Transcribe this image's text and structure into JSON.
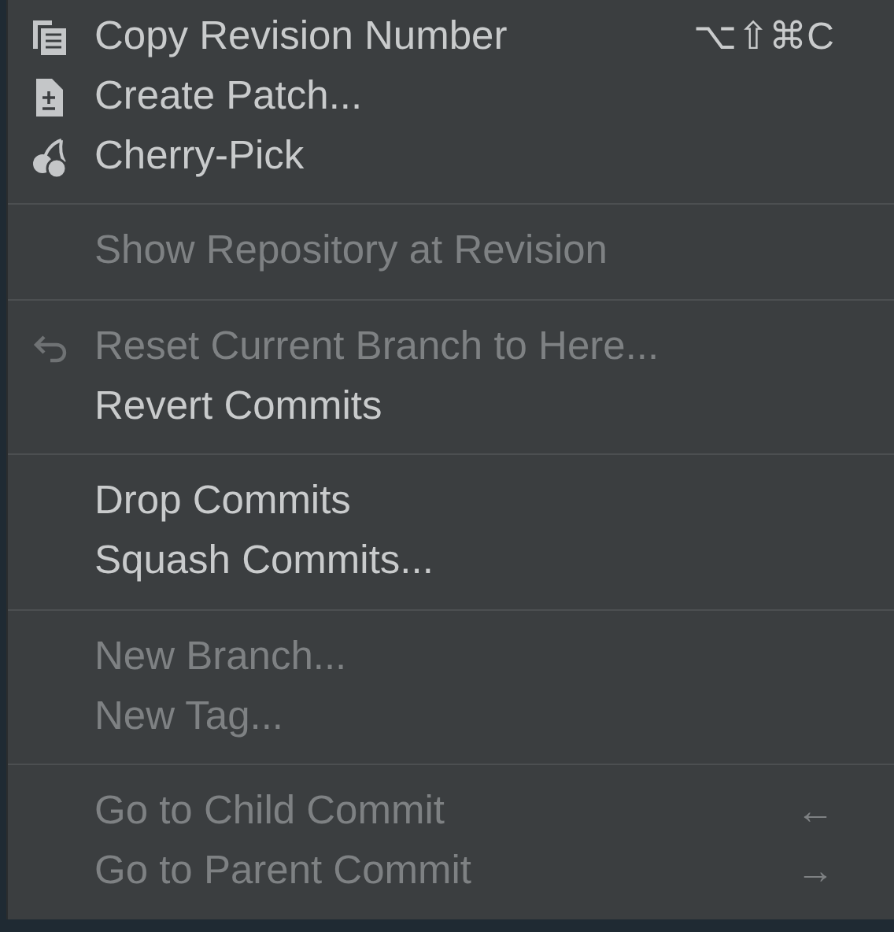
{
  "menu": {
    "groups": [
      {
        "items": [
          {
            "label": "Copy Revision Number",
            "disabled": false,
            "shortcut": "⌥⇧⌘C"
          },
          {
            "label": "Create Patch...",
            "disabled": false
          },
          {
            "label": "Cherry-Pick",
            "disabled": false
          }
        ]
      },
      {
        "items": [
          {
            "label": "Show Repository at Revision",
            "disabled": true
          }
        ]
      },
      {
        "items": [
          {
            "label": "Reset Current Branch to Here...",
            "disabled": true
          },
          {
            "label": "Revert Commits",
            "disabled": false
          }
        ]
      },
      {
        "items": [
          {
            "label": "Drop Commits",
            "disabled": false
          },
          {
            "label": "Squash Commits...",
            "disabled": false
          }
        ]
      },
      {
        "items": [
          {
            "label": "New Branch...",
            "disabled": true
          },
          {
            "label": "New Tag...",
            "disabled": true
          }
        ]
      },
      {
        "items": [
          {
            "label": "Go to Child Commit",
            "disabled": true,
            "shortcut": "←"
          },
          {
            "label": "Go to Parent Commit",
            "disabled": true,
            "shortcut": "→"
          }
        ]
      }
    ]
  }
}
